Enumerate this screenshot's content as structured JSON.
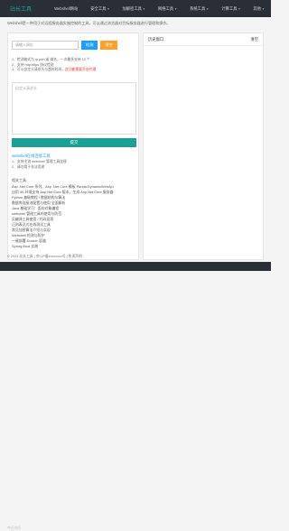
{
  "header": {
    "brand": "站长工具",
    "nav": [
      {
        "label": "Webshell网站"
      },
      {
        "label": "安全工具",
        "caret": true
      },
      {
        "label": "加解密工具",
        "caret": true
      },
      {
        "label": "网络工具",
        "caret": true
      },
      {
        "label": "系统工具",
        "caret": true
      },
      {
        "label": "计算工具",
        "caret": true
      },
      {
        "label": "其他",
        "caret": true
      }
    ]
  },
  "intro": "Webshell是一种用于对远程服务器实施控制的工具，可以通过浏览器对目标服务器进行管理和操作。",
  "form": {
    "placeholder": "请输入网址",
    "check_label": "检测",
    "reset_label": "清空",
    "steps": [
      "1、检测格式为 ip:port 或 域名，一次最多支持 10 个",
      "2、支持 http/https 协议检测",
      "3、可以自定义请求头与超时时间，",
      "   结果仅供参考"
    ],
    "step_red": "此功能需要开启代理",
    "textarea_placeholder": "自定义请求头",
    "submit_label": "提交"
  },
  "section2": {
    "title": "webshell在线连接工具",
    "steps": [
      "1、支持主流 webshell 管理工具连接",
      "2、请勿用于非法用途"
    ]
  },
  "links": {
    "heading": "相关工具:",
    "items": [
      "Asp .Net Core 系列、Asp .Net Core 模板 Panda.DynamicWebApi",
      "自用 IIS 环境支持 Asp.Net Core 版本，生成 Asp.Net Core 服务器",
      "Python 基础教程 / 数据结构与算法",
      "数据库连接池配置与使用 全面解析",
      "Java 基础学习：面向对象编程",
      "webshell 管理工具的使用与防范",
      "反编译工具使用 / 代码混淆",
      "正则表达式在线测试工具",
      "常见加密算法介绍与实现",
      "Webshell 检测与防护",
      "一键部署 Docker 容器",
      "Spring Boot 实践"
    ]
  },
  "side": {
    "title": "历史窗口",
    "action": "清空"
  },
  "footer": {
    "copyright": "© 2023 站长工具 | 京ICP备xxxxxxxx号 | 免责声明",
    "stat": "今日访问"
  }
}
